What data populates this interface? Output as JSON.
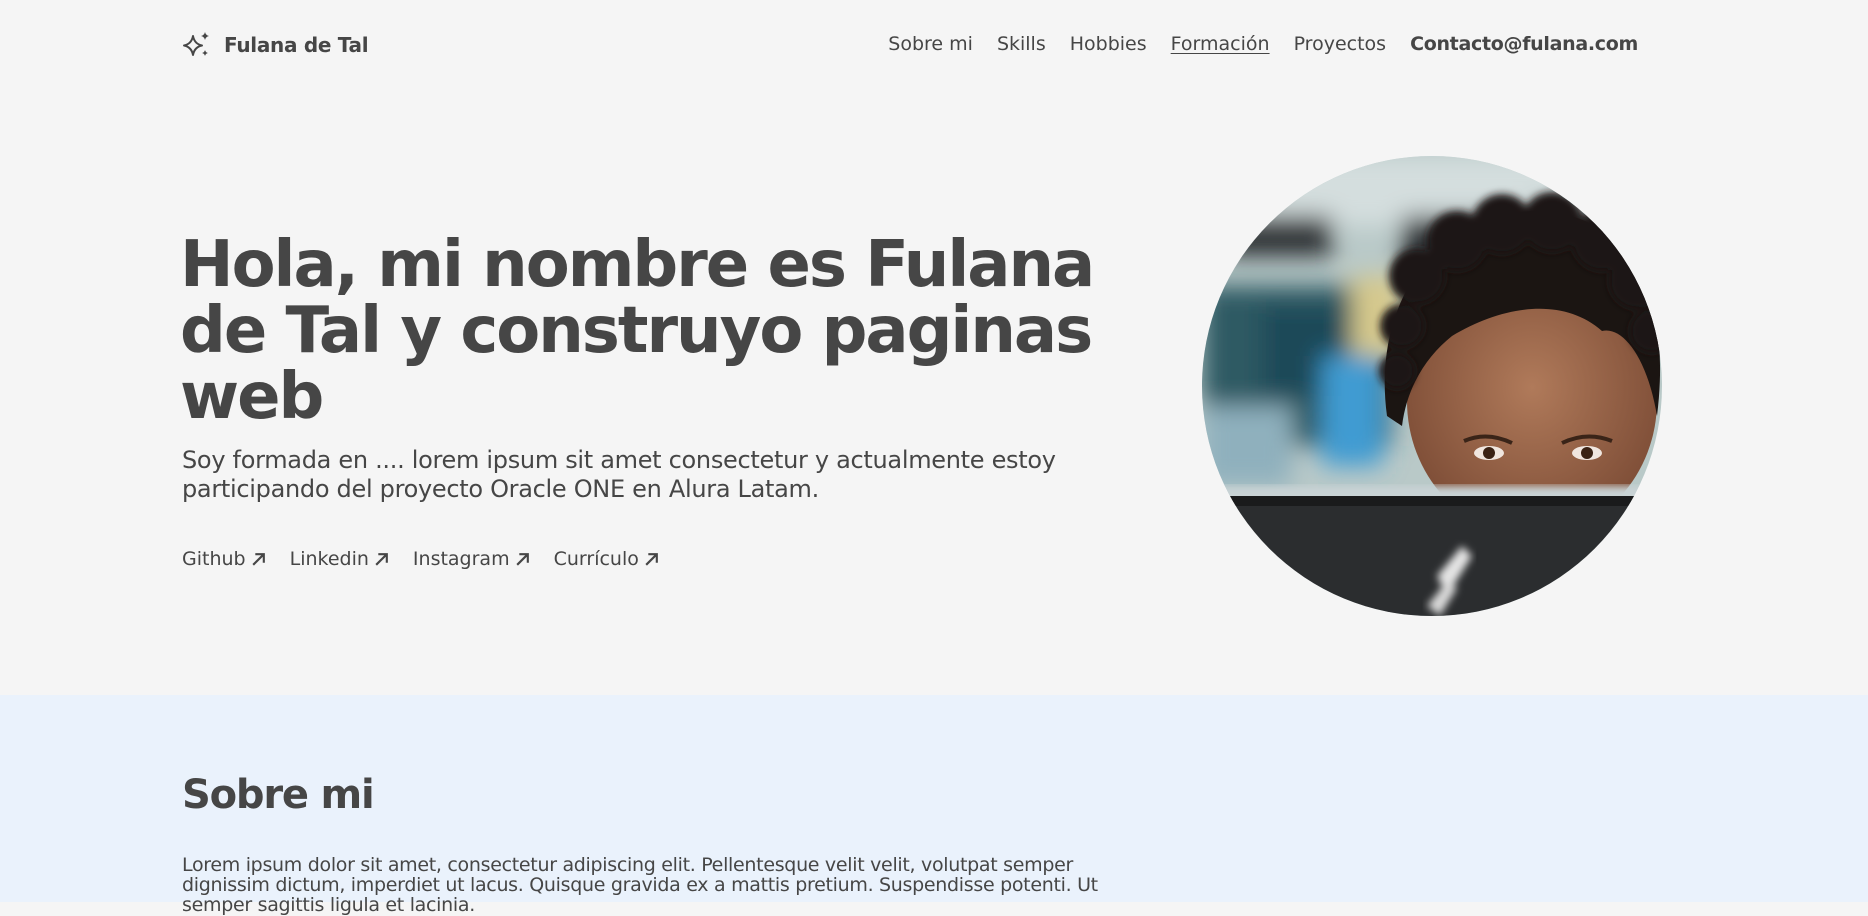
{
  "header": {
    "logo_text": "Fulana de Tal",
    "logo_icon": "sparkles-icon",
    "nav": [
      {
        "label": "Sobre mi"
      },
      {
        "label": "Skills"
      },
      {
        "label": "Hobbies"
      },
      {
        "label": "Formación"
      },
      {
        "label": "Proyectos"
      },
      {
        "label": "Contacto@fulana.com"
      }
    ]
  },
  "hero": {
    "title": "Hola, mi nombre es Fulana de Tal y construyo paginas web",
    "description": "Soy formada en .... lorem ipsum sit amet consectetur y actualmente estoy participando del proyecto Oracle ONE en Alura Latam.",
    "links": [
      {
        "label": "Github",
        "icon": "arrow-up-right-icon"
      },
      {
        "label": "Linkedin",
        "icon": "arrow-up-right-icon"
      },
      {
        "label": "Instagram",
        "icon": "arrow-up-right-icon"
      },
      {
        "label": "Currículo",
        "icon": "arrow-up-right-icon"
      }
    ]
  },
  "about": {
    "title": "Sobre mi",
    "text": "Lorem ipsum dolor sit amet, consectetur adipiscing elit. Pellentesque velit velit, volutpat semper dignissim dictum, imperdiet ut lacus. Quisque gravida ex a mattis pretium. Suspendisse potenti. Ut semper sagittis ligula et lacinia."
  },
  "colors": {
    "text": "#464646",
    "background": "#f5f5f5",
    "about_background": "#eaf2fc"
  }
}
